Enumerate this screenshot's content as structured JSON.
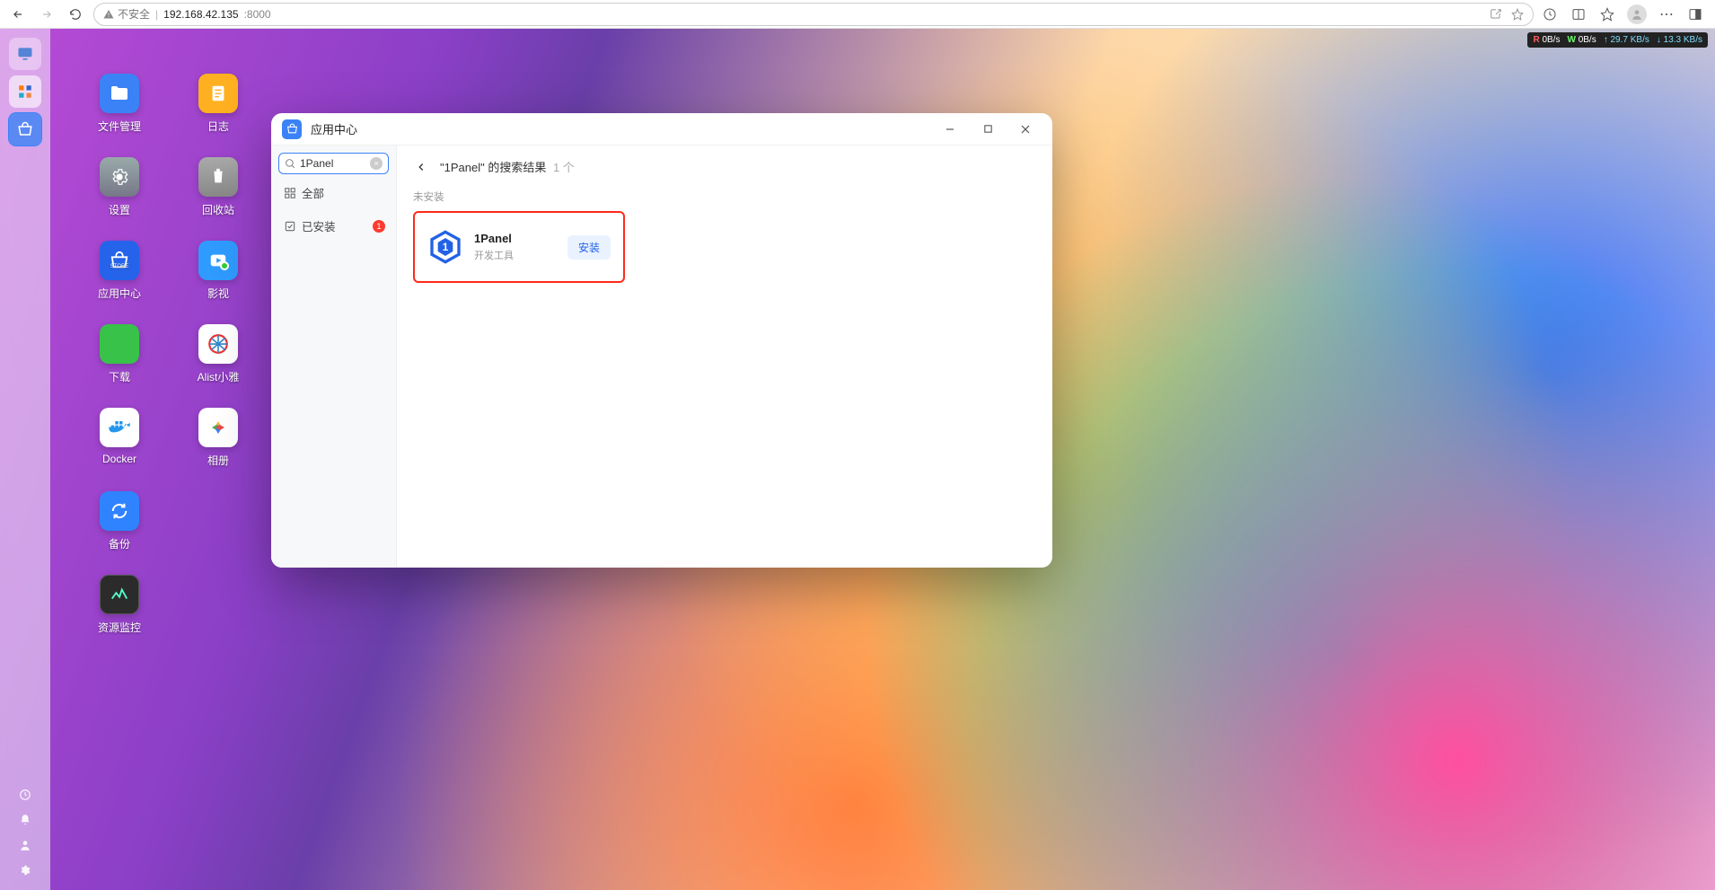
{
  "browser": {
    "security_label": "不安全",
    "url_host": "192.168.42.135",
    "url_port": ":8000"
  },
  "netstats": {
    "r_label": "R",
    "r_value": "0B/s",
    "w_label": "W",
    "w_value": "0B/s",
    "up_value": "29.7 KB/s",
    "down_value": "13.3 KB/s"
  },
  "dock_items": [
    {
      "name": "monitor",
      "emoji": "🖥️",
      "bg": "rgba(255,255,255,0.4)"
    },
    {
      "name": "apps-grid",
      "emoji": "🟧",
      "bg": "rgba(255,255,255,0.6)"
    },
    {
      "name": "store",
      "emoji": "🛍️",
      "bg": "#3b82f6",
      "active": true
    }
  ],
  "desktop_icons": [
    {
      "label": "文件管理",
      "bg": "#3b82f6",
      "glyph": "folder"
    },
    {
      "label": "日志",
      "bg": "#ffb020",
      "glyph": "list"
    },
    {
      "label": "设置",
      "bg": "#888",
      "glyph": "gear"
    },
    {
      "label": "回收站",
      "bg": "#999",
      "glyph": "recycle"
    },
    {
      "label": "应用中心",
      "bg": "#2563eb",
      "glyph": "bag"
    },
    {
      "label": "影视",
      "bg": "#2f9bff",
      "glyph": "media"
    },
    {
      "label": "下载",
      "bg": "#38c24a",
      "glyph": "down"
    },
    {
      "label": "Alist小雅",
      "bg": "#fff",
      "glyph": "wheel"
    },
    {
      "label": "Docker",
      "bg": "#fff",
      "glyph": "docker"
    },
    {
      "label": "相册",
      "bg": "#fff",
      "glyph": "photo"
    },
    {
      "label": "备份",
      "bg": "#2f83ff",
      "glyph": "sync"
    },
    {
      "label": "",
      "bg": "",
      "glyph": ""
    },
    {
      "label": "资源监控",
      "bg": "#2b2b2b",
      "glyph": "chart"
    }
  ],
  "window": {
    "title": "应用中心",
    "search_value": "1Panel",
    "sidebar": {
      "all": "全部",
      "installed": "已安装",
      "installed_badge": "1"
    },
    "results": {
      "header_prefix": "\"1Panel\" 的搜索结果",
      "count": "1 个",
      "section": "未安装",
      "app": {
        "name": "1Panel",
        "category": "开发工具",
        "install_label": "安装"
      }
    }
  }
}
